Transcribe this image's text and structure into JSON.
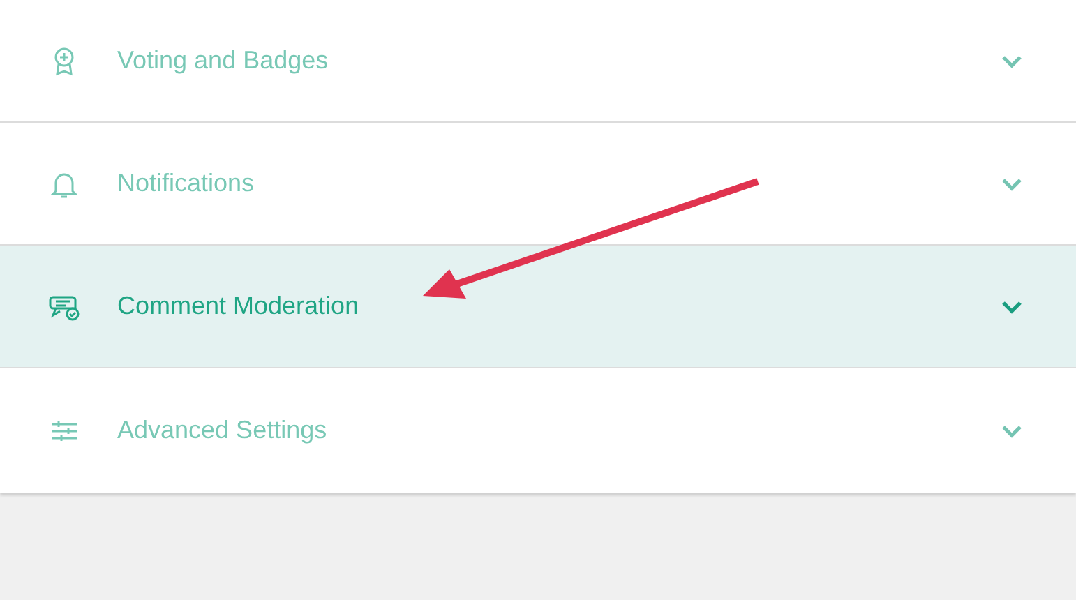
{
  "sections": [
    {
      "label": "Voting and Badges",
      "selected": false,
      "dimmed": true
    },
    {
      "label": "Notifications",
      "selected": false,
      "dimmed": true
    },
    {
      "label": "Comment Moderation",
      "selected": true,
      "dimmed": false
    },
    {
      "label": "Advanced Settings",
      "selected": false,
      "dimmed": true
    }
  ]
}
